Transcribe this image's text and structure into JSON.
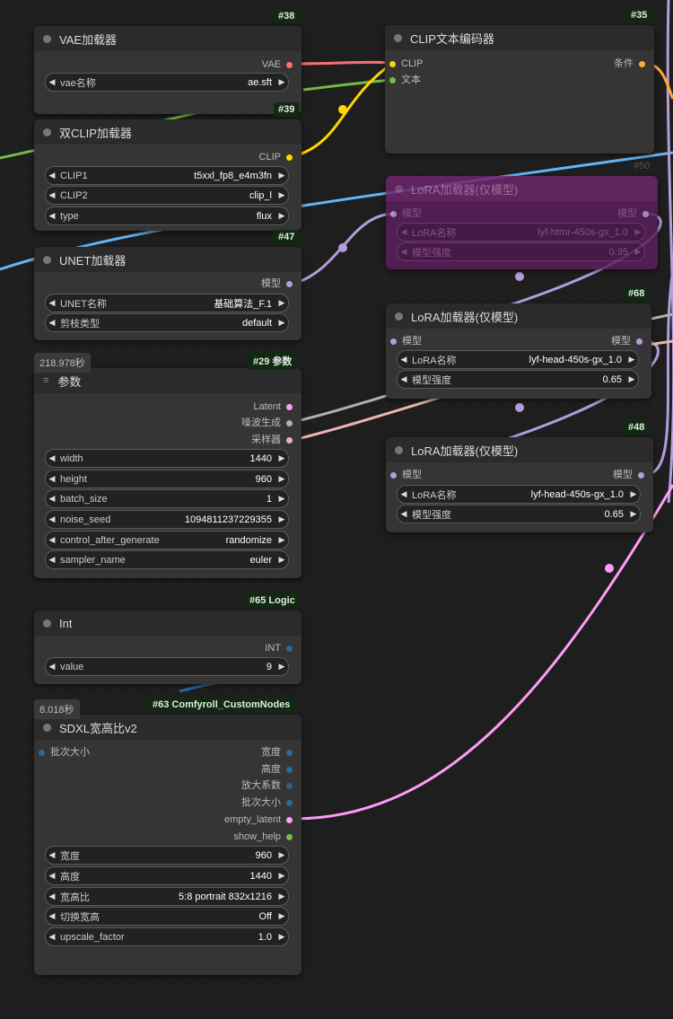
{
  "nodes": {
    "vae": {
      "id": "#38",
      "title": "VAE加载器",
      "out": [
        "VAE"
      ],
      "widgets": [
        {
          "label": "vae名称",
          "value": "ae.sft"
        }
      ]
    },
    "dualclip": {
      "id": "#39",
      "title": "双CLIP加载器",
      "out": [
        "CLIP"
      ],
      "widgets": [
        {
          "label": "CLIP1",
          "value": "t5xxl_fp8_e4m3fn"
        },
        {
          "label": "CLIP2",
          "value": "clip_l"
        },
        {
          "label": "type",
          "value": "flux"
        }
      ]
    },
    "unet": {
      "id": "#47",
      "title": "UNET加载器",
      "out": [
        "模型"
      ],
      "widgets": [
        {
          "label": "UNET名称",
          "value": "基础算法_F.1"
        },
        {
          "label": "剪枝类型",
          "value": "default"
        }
      ]
    },
    "params": {
      "id": "#29 参数",
      "timer": "218.978秒",
      "title": "参数",
      "out": [
        "Latent",
        "噪波生成",
        "采样器"
      ],
      "widgets": [
        {
          "label": "width",
          "value": "1440"
        },
        {
          "label": "height",
          "value": "960"
        },
        {
          "label": "batch_size",
          "value": "1"
        },
        {
          "label": "noise_seed",
          "value": "1094811237229355"
        },
        {
          "label": "control_after_generate",
          "value": "randomize"
        },
        {
          "label": "sampler_name",
          "value": "euler"
        }
      ]
    },
    "int": {
      "id": "#65 Logic",
      "title": "Int",
      "out": [
        "INT"
      ],
      "widgets": [
        {
          "label": "value",
          "value": "9"
        }
      ]
    },
    "sdxl": {
      "id": "#63 Comfyroll_CustomNodes",
      "timer": "8.018秒",
      "title": "SDXL宽高比v2",
      "in": [
        "批次大小"
      ],
      "out": [
        "宽度",
        "高度",
        "放大系数",
        "批次大小",
        "empty_latent",
        "show_help"
      ],
      "widgets": [
        {
          "label": "宽度",
          "value": "960"
        },
        {
          "label": "高度",
          "value": "1440"
        },
        {
          "label": "宽高比",
          "value": "5:8 portrait 832x1216"
        },
        {
          "label": "切换宽高",
          "value": "Off"
        },
        {
          "label": "upscale_factor",
          "value": "1.0"
        }
      ]
    },
    "clipenc": {
      "id": "#35",
      "title": "CLIP文本编码器",
      "in": [
        "CLIP",
        "文本"
      ],
      "out": [
        "条件"
      ]
    },
    "lora50": {
      "id": "#50",
      "title": "LoRA加载器(仅模型)",
      "in": [
        "模型"
      ],
      "out": [
        "模型"
      ],
      "widgets": [
        {
          "label": "LoRA名称",
          "value": "lyf-htmr-450s-gx_1.0"
        },
        {
          "label": "模型强度",
          "value": "0.95"
        }
      ]
    },
    "lora68": {
      "id": "#68",
      "title": "LoRA加载器(仅模型)",
      "in": [
        "模型"
      ],
      "out": [
        "模型"
      ],
      "widgets": [
        {
          "label": "LoRA名称",
          "value": "lyf-head-450s-gx_1.0"
        },
        {
          "label": "模型强度",
          "value": "0.65"
        }
      ]
    },
    "lora48": {
      "id": "#48",
      "title": "LoRA加载器(仅模型)",
      "in": [
        "模型"
      ],
      "out": [
        "模型"
      ],
      "widgets": [
        {
          "label": "LoRA名称",
          "value": "lyf-head-450s-gx_1.0"
        },
        {
          "label": "模型强度",
          "value": "0.65"
        }
      ]
    }
  },
  "colors": {
    "vae": "#ff6e6e",
    "clip": "#ffd500",
    "conditioning": "#ffa931",
    "model": "#b39ddb",
    "latent": "#ff9cf9",
    "noise": "#b0b0b0",
    "sampler": "#ecb4b4",
    "int": "#29699c",
    "string": "#77bb41",
    "blue": "#64b5f6"
  }
}
